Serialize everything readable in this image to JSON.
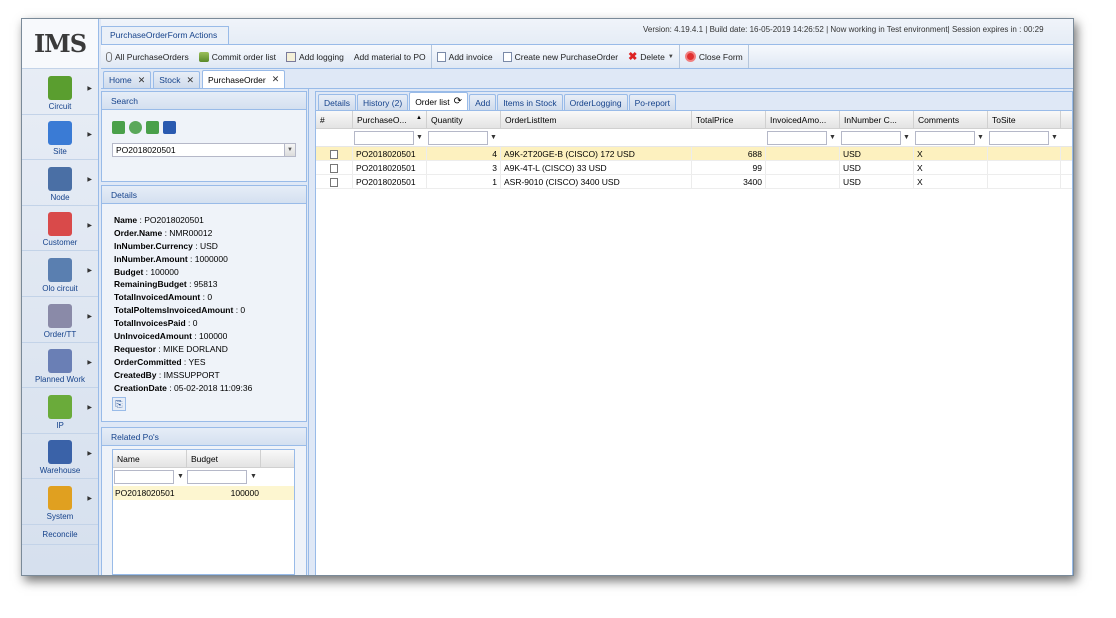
{
  "app": {
    "logo": "IMS",
    "actions_title": "PurchaseOrderForm Actions",
    "version_text": "Version: 4.19.4.1 | Build date: 16-05-2019 14:26:52 | Now working in Test environment| Session expires in : 00:29"
  },
  "nav": {
    "items": [
      {
        "label": "Circuit",
        "icon": "circuit-icon",
        "color": "#5a9e2f"
      },
      {
        "label": "Site",
        "icon": "site-icon",
        "color": "#3a7bd5"
      },
      {
        "label": "Node",
        "icon": "node-icon",
        "color": "#4a6fa5"
      },
      {
        "label": "Customer",
        "icon": "customer-icon",
        "color": "#d94a4a"
      },
      {
        "label": "Olo circuit",
        "icon": "olo-circuit-icon",
        "color": "#5a7fb0"
      },
      {
        "label": "Order/TT",
        "icon": "order-tt-icon",
        "color": "#8a8aa8"
      },
      {
        "label": "Planned Work",
        "icon": "planned-work-icon",
        "color": "#6a7fb5"
      },
      {
        "label": "IP",
        "icon": "ip-icon",
        "color": "#6aab3a"
      },
      {
        "label": "Warehouse",
        "icon": "warehouse-icon",
        "color": "#3a62a8"
      },
      {
        "label": "System",
        "icon": "system-icon",
        "color": "#e0a020"
      }
    ],
    "reconcile": "Reconcile"
  },
  "toolbar": {
    "all_purchase_orders": "All PurchaseOrders",
    "commit_order_list": "Commit order list",
    "add_logging": "Add logging",
    "add_material": "Add material to PO",
    "add_invoice": "Add invoice",
    "create_new": "Create new PurchaseOrder",
    "delete": "Delete",
    "close_form": "Close Form"
  },
  "tabs": [
    {
      "label": "Home"
    },
    {
      "label": "Stock"
    },
    {
      "label": "PurchaseOrder"
    }
  ],
  "search": {
    "title": "Search",
    "value": "PO2018020501"
  },
  "details": {
    "title": "Details",
    "rows": [
      {
        "key": "Name",
        "value": "PO2018020501"
      },
      {
        "key": "Order.Name",
        "value": "NMR00012"
      },
      {
        "key": "InNumber.Currency",
        "value": "USD"
      },
      {
        "key": "InNumber.Amount",
        "value": "1000000"
      },
      {
        "key": "Budget",
        "value": "100000"
      },
      {
        "key": "RemainingBudget",
        "value": "95813"
      },
      {
        "key": "TotalInvoicedAmount",
        "value": "0"
      },
      {
        "key": "TotalPoItemsInvoicedAmount",
        "value": "0"
      },
      {
        "key": "TotalInvoicesPaid",
        "value": "0"
      },
      {
        "key": "UnInvoicedAmount",
        "value": "100000"
      },
      {
        "key": "Requestor",
        "value": "MIKE DORLAND"
      },
      {
        "key": "OrderCommitted",
        "value": "YES"
      },
      {
        "key": "CreatedBy",
        "value": "IMSSUPPORT"
      },
      {
        "key": "CreationDate",
        "value": "05-02-2018 11:09:36"
      }
    ]
  },
  "related": {
    "title": "Related Po's",
    "columns": [
      "Name",
      "Budget"
    ],
    "rows": [
      {
        "name": "PO2018020501",
        "budget": "100000"
      }
    ]
  },
  "subtabs": [
    {
      "label": "Details"
    },
    {
      "label": "History (2)"
    },
    {
      "label": "Order list"
    },
    {
      "label": "Add"
    },
    {
      "label": "Items in Stock"
    },
    {
      "label": "OrderLogging"
    },
    {
      "label": "Po-report"
    }
  ],
  "grid": {
    "columns": [
      "#",
      "PurchaseO...",
      "Quantity",
      "OrderListItem",
      "TotalPrice",
      "InvoicedAmo...",
      "InNumber C...",
      "Comments",
      "ToSite"
    ],
    "rows": [
      {
        "po": "PO2018020501",
        "qty": "4",
        "item": "A9K-2T20GE-B (CISCO) 172 USD",
        "total": "688",
        "invoiced": "",
        "currency": "USD",
        "comments": "X",
        "tosite": ""
      },
      {
        "po": "PO2018020501",
        "qty": "3",
        "item": "A9K-4T-L (CISCO) 33 USD",
        "total": "99",
        "invoiced": "",
        "currency": "USD",
        "comments": "X",
        "tosite": ""
      },
      {
        "po": "PO2018020501",
        "qty": "1",
        "item": "ASR-9010 (CISCO) 3400 USD",
        "total": "3400",
        "invoiced": "",
        "currency": "USD",
        "comments": "X",
        "tosite": ""
      }
    ]
  }
}
